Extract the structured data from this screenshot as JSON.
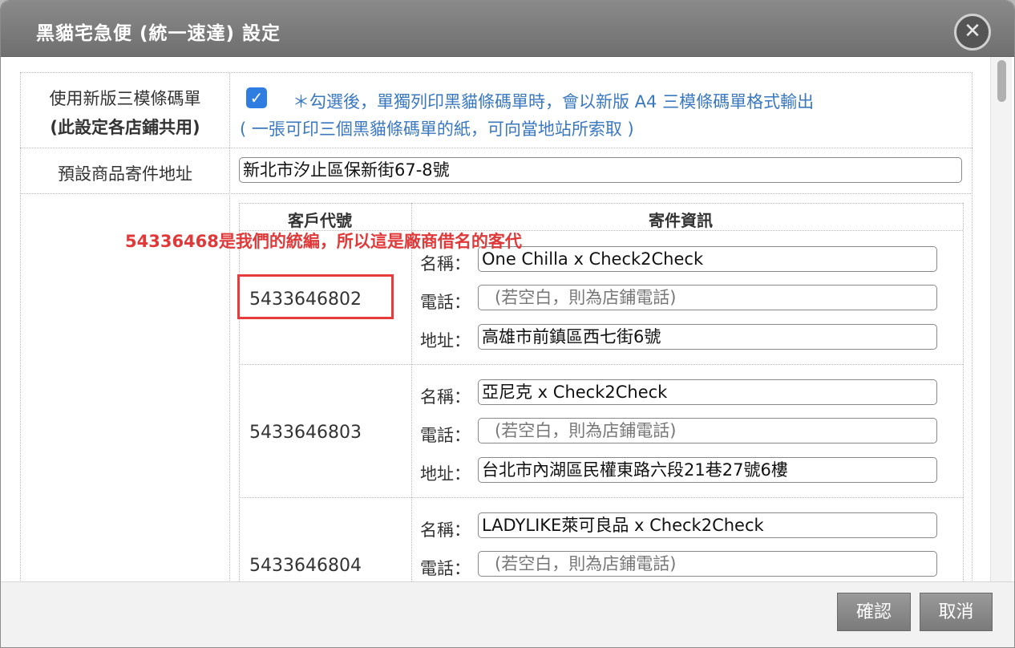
{
  "dialog": {
    "title": "黑貓宅急便 (統一速達) 設定",
    "close_icon": "✕"
  },
  "settings": {
    "barcode_label_line1": "使用新版三模條碼單",
    "barcode_label_line2": "(此設定各店鋪共用)",
    "barcode_checked": true,
    "barcode_hint_line1": "＊勾選後，單獨列印黑貓條碼單時，會以新版 A4 三模條碼單格式輸出",
    "barcode_hint_line2": "( 一張可印三個黑貓條碼單的紙，可向當地站所索取 )",
    "address_label": "預設商品寄件地址",
    "address_value": "新北市汐止區保新街67-8號"
  },
  "customer_table": {
    "header_code": "客戶代號",
    "header_info": "寄件資訊",
    "label_name": "名稱：",
    "label_phone": "電話：",
    "label_address": "地址：",
    "phone_placeholder": "(若空白，則為店鋪電話)",
    "rows": [
      {
        "code": "5433646802",
        "name": "One Chilla x Check2Check",
        "address": "高雄市前鎮區西七街6號"
      },
      {
        "code": "5433646803",
        "name": "亞尼克 x Check2Check",
        "address": "台北市內湖區民權東路六段21巷27號6樓"
      },
      {
        "code": "5433646804",
        "name": "LADYLIKE萊可良品 x Check2Check"
      }
    ]
  },
  "annotation": "54336468是我們的統編，所以這是廠商借名的客代",
  "footer": {
    "confirm_label": "確認",
    "cancel_label": "取消"
  },
  "colors": {
    "titlebar": "#7d7d7d",
    "hint_text": "#3a78c0",
    "annotation_red": "#e0393a",
    "checkbox_blue": "#2f7de1"
  }
}
